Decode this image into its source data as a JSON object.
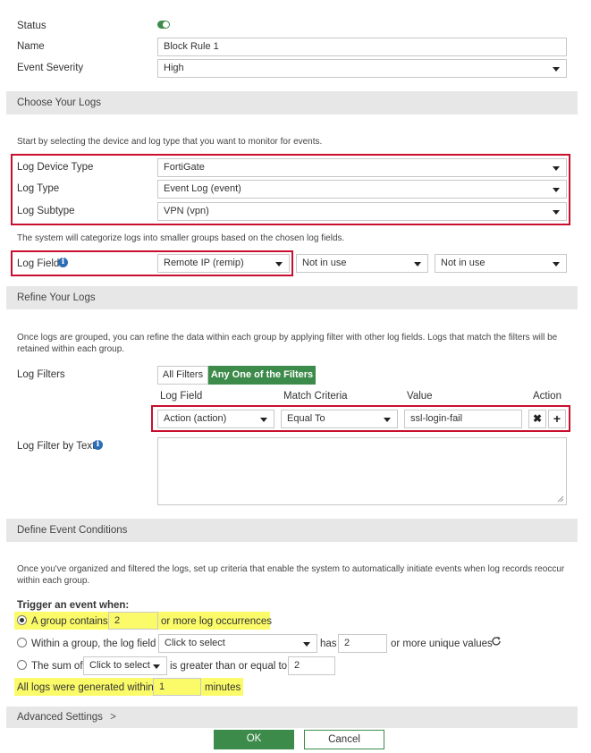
{
  "general": {
    "status_label": "Status",
    "name_label": "Name",
    "name_value": "Block Rule 1",
    "severity_label": "Event Severity",
    "severity_value": "High"
  },
  "logs_section": {
    "title": "Choose Your Logs",
    "hint": "Start by selecting the device and log type that you want to monitor for events.",
    "device_type_label": "Log Device Type",
    "device_type_value": "FortiGate",
    "log_type_label": "Log Type",
    "log_type_value": "Event Log (event)",
    "log_subtype_label": "Log Subtype",
    "log_subtype_value": "VPN (vpn)",
    "group_hint": "The system will categorize logs into smaller groups based on the chosen log fields.",
    "log_field_label": "Log Field",
    "log_field_1": "Remote IP (remip)",
    "log_field_2": "Not in use",
    "log_field_3": "Not in use"
  },
  "refine_section": {
    "title": "Refine Your Logs",
    "hint_line1": "Once logs are grouped, you can refine the data within each group by applying filter with other log fields. Logs that match the filters will be",
    "hint_line2": "retained within each group.",
    "filters_label": "Log Filters",
    "toggle_all": "All Filters",
    "toggle_any": "Any One of the Filters",
    "col_field": "Log Field",
    "col_criteria": "Match Criteria",
    "col_value": "Value",
    "col_action": "Action",
    "row_field": "Action (action)",
    "row_criteria": "Equal To",
    "row_value": "ssl-login-fail",
    "filter_text_label": "Log Filter by Text"
  },
  "conditions_section": {
    "title": "Define Event Conditions",
    "hint_line1": "Once you've organized and filtered the logs, set up criteria that enable the system to automatically initiate events when log records reoccur",
    "hint_line2": "within each group.",
    "trigger_label": "Trigger an event when:",
    "opt1_prefix": "A group contains",
    "opt1_value": "2",
    "opt1_suffix": "or more log occurrences",
    "opt2_prefix": "Within a group, the log field",
    "opt2_select": "Click to select",
    "opt2_has": "has",
    "opt2_value": "2",
    "opt2_suffix": "or more unique values",
    "opt3_prefix": "The sum of",
    "opt3_select": "Click to select",
    "opt3_middle": "is greater than or equal to",
    "opt3_value": "2",
    "all_logs_prefix": "All logs were generated within",
    "all_logs_value": "1",
    "all_logs_suffix": "minutes"
  },
  "advanced": {
    "label": "Advanced Settings"
  },
  "footer": {
    "ok": "OK",
    "cancel": "Cancel"
  },
  "colors": {
    "green": "#3d8b4a",
    "red_box": "#c8102e",
    "highlight": "#fbfb6a",
    "section_bg": "#e7e7e7"
  }
}
